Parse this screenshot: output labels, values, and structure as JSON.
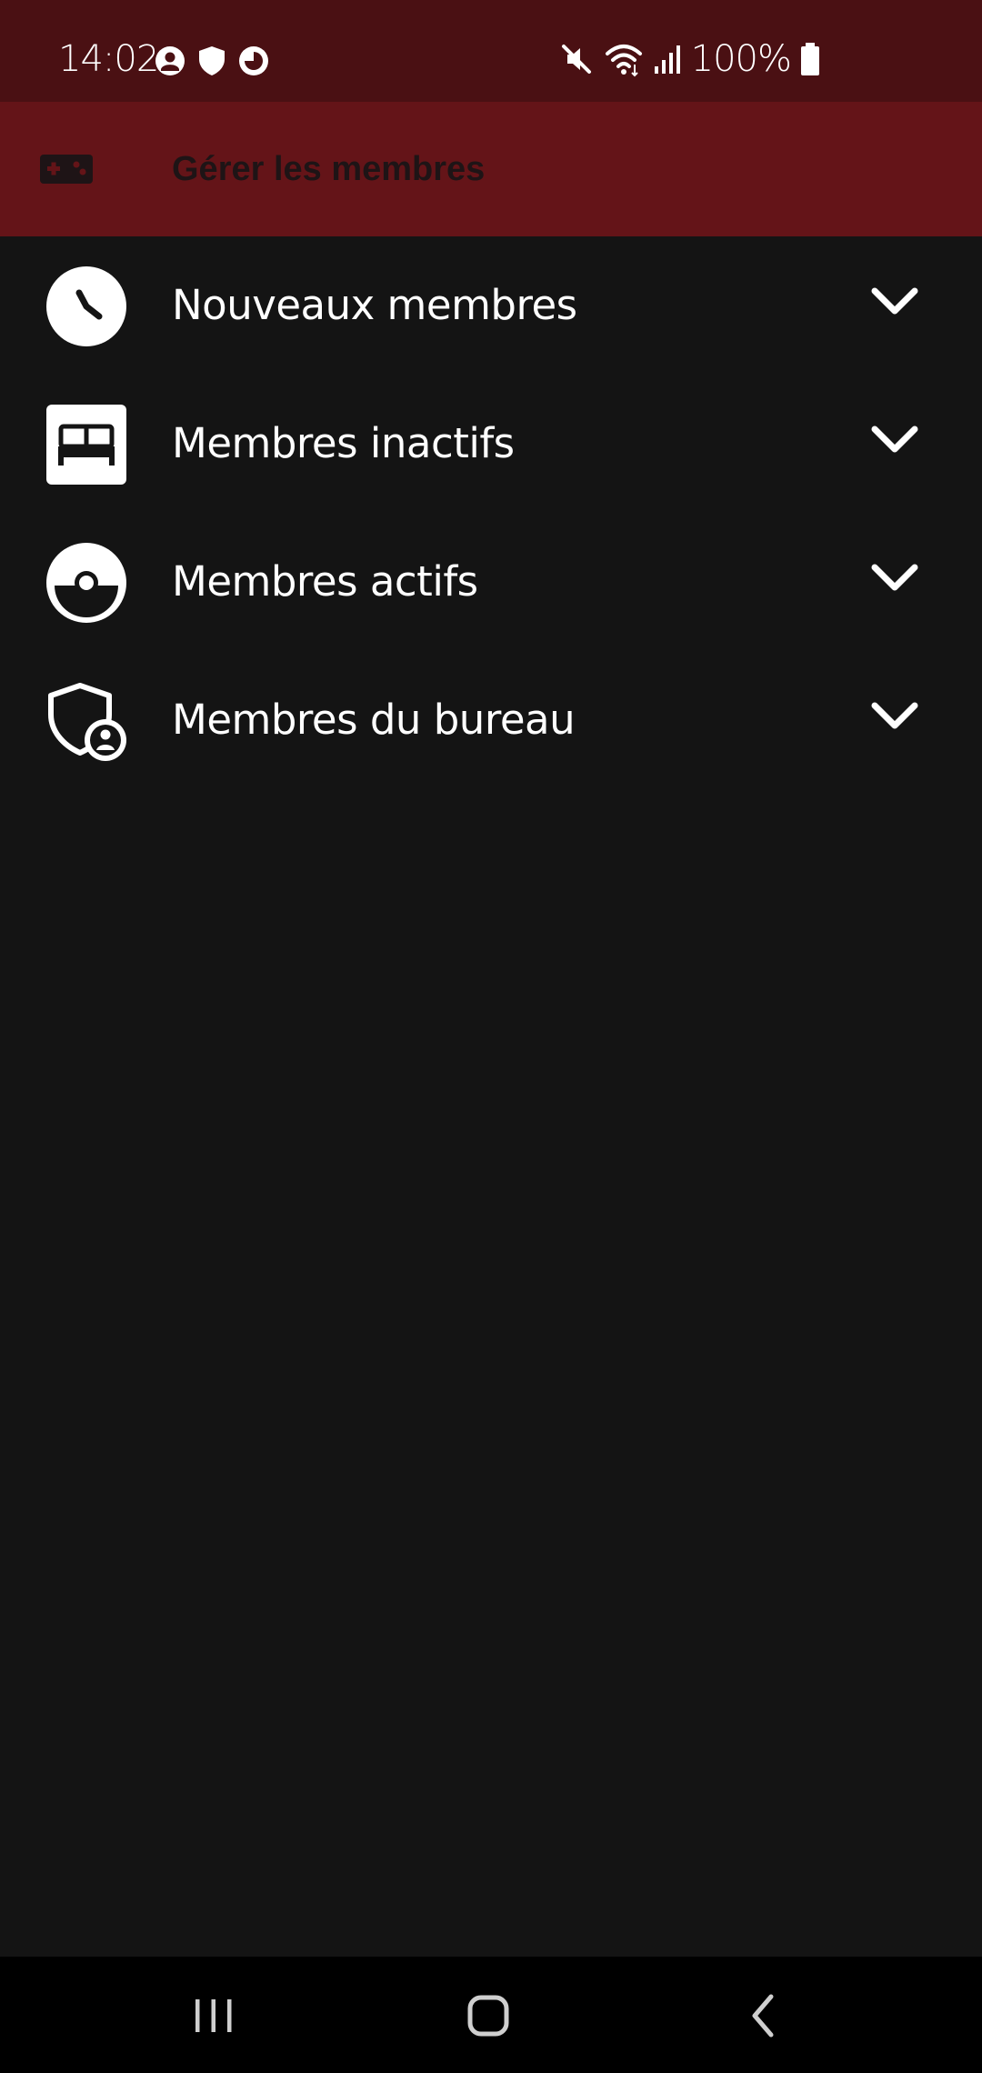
{
  "status_bar": {
    "time": "14:02",
    "battery": "100%",
    "left_icons": [
      "account-circle-icon",
      "shield-icon",
      "data-saver-icon"
    ],
    "right_icons": [
      "mute-icon",
      "wifi-icon",
      "signal-icon",
      "battery-icon"
    ]
  },
  "app_bar": {
    "title": "Gérer les membres",
    "icon": "gamepad-icon"
  },
  "menu": {
    "items": [
      {
        "label": "Nouveaux membres",
        "icon": "clock-icon"
      },
      {
        "label": "Membres inactifs",
        "icon": "bed-icon"
      },
      {
        "label": "Membres actifs",
        "icon": "pokeball-icon"
      },
      {
        "label": "Membres du bureau",
        "icon": "shield-account-icon"
      }
    ]
  },
  "nav_bar": {
    "buttons": [
      "recent-apps",
      "home",
      "back"
    ]
  },
  "colors": {
    "status_bar_bg": "#4a1013",
    "app_bar_bg": "#641418",
    "background": "#141414",
    "text": "#ffffff"
  }
}
